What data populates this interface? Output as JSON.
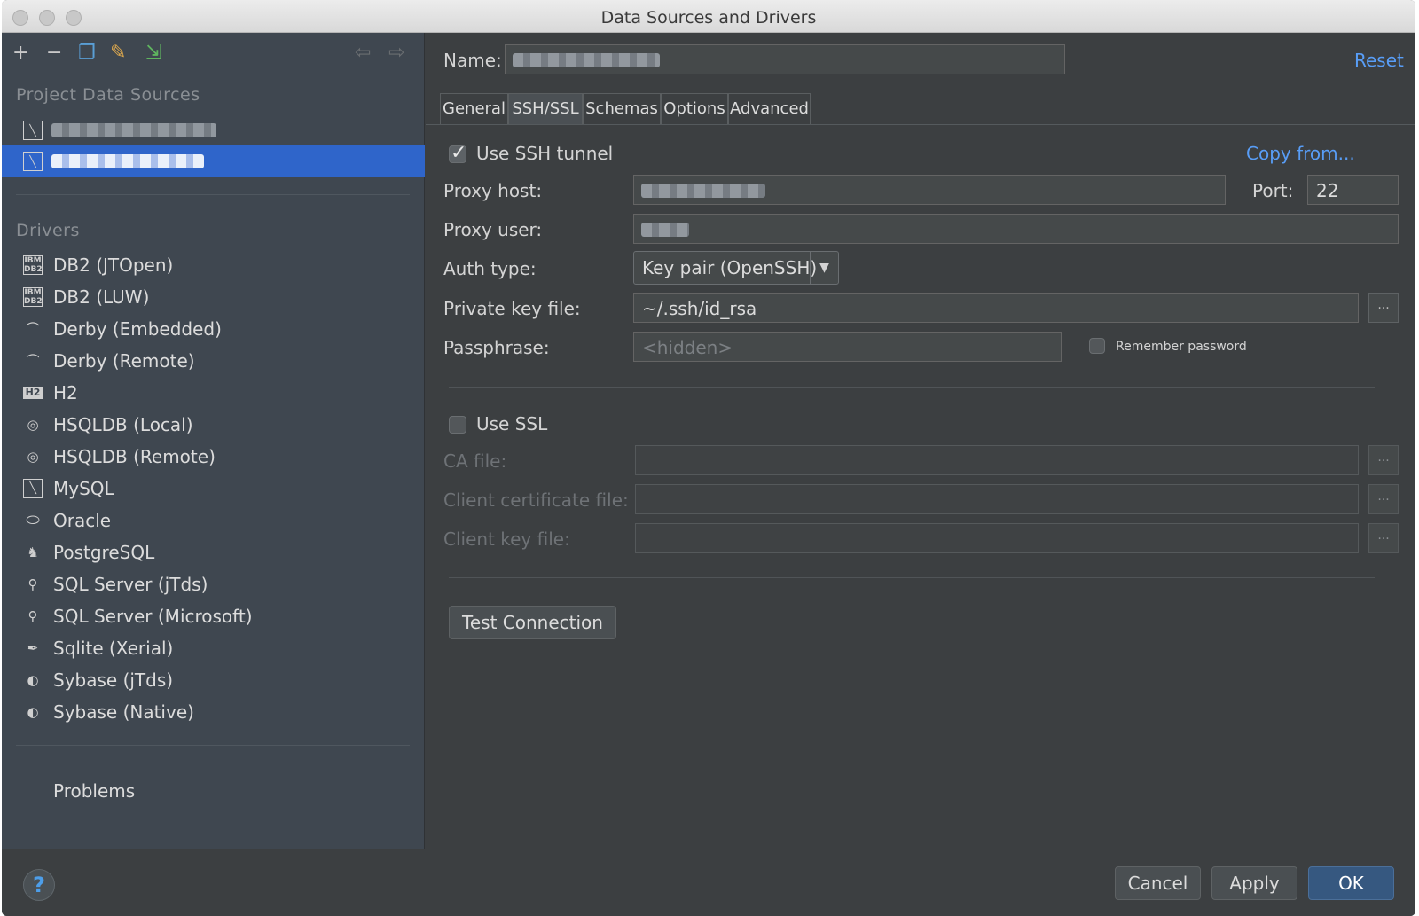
{
  "window": {
    "title": "Data Sources and Drivers"
  },
  "left": {
    "project_title": "Project Data Sources",
    "drivers_title": "Drivers",
    "drivers": [
      {
        "label": "DB2 (JTOpen)",
        "icon": "ibm-db2-icon"
      },
      {
        "label": "DB2 (LUW)",
        "icon": "ibm-db2-icon"
      },
      {
        "label": "Derby (Embedded)",
        "icon": "derby-hat-icon"
      },
      {
        "label": "Derby (Remote)",
        "icon": "derby-hat-icon"
      },
      {
        "label": "H2",
        "icon": "h2-icon"
      },
      {
        "label": "HSQLDB (Local)",
        "icon": "hsqldb-icon"
      },
      {
        "label": "HSQLDB (Remote)",
        "icon": "hsqldb-icon"
      },
      {
        "label": "MySQL",
        "icon": "mysql-icon"
      },
      {
        "label": "Oracle",
        "icon": "oracle-icon"
      },
      {
        "label": "PostgreSQL",
        "icon": "postgresql-icon"
      },
      {
        "label": "SQL Server (jTds)",
        "icon": "sqlserver-icon"
      },
      {
        "label": "SQL Server (Microsoft)",
        "icon": "sqlserver-icon"
      },
      {
        "label": "Sqlite (Xerial)",
        "icon": "sqlite-icon"
      },
      {
        "label": "Sybase (jTds)",
        "icon": "sybase-icon"
      },
      {
        "label": "Sybase (Native)",
        "icon": "sybase-icon"
      }
    ],
    "problems": "Problems"
  },
  "right": {
    "name_label": "Name:",
    "reset": "Reset",
    "tabs": [
      "General",
      "SSH/SSL",
      "Schemas",
      "Options",
      "Advanced"
    ],
    "active_tab": "SSH/SSL",
    "ssh": {
      "use_ssh_label": "Use SSH tunnel",
      "use_ssh_checked": true,
      "copy_from": "Copy from...",
      "proxy_host_label": "Proxy host:",
      "port_label": "Port:",
      "port_value": "22",
      "proxy_user_label": "Proxy user:",
      "auth_type_label": "Auth type:",
      "auth_type_value": "Key pair (OpenSSH)",
      "private_key_label": "Private key file:",
      "private_key_value": "~/.ssh/id_rsa",
      "passphrase_label": "Passphrase:",
      "passphrase_placeholder": "<hidden>",
      "remember_password_label": "Remember password"
    },
    "ssl": {
      "use_ssl_label": "Use SSL",
      "ca_file_label": "CA file:",
      "client_cert_label": "Client certificate file:",
      "client_key_label": "Client key file:"
    },
    "browse_label": "...",
    "test_connection": "Test Connection"
  },
  "footer": {
    "help": "?",
    "cancel": "Cancel",
    "apply": "Apply",
    "ok": "OK"
  }
}
